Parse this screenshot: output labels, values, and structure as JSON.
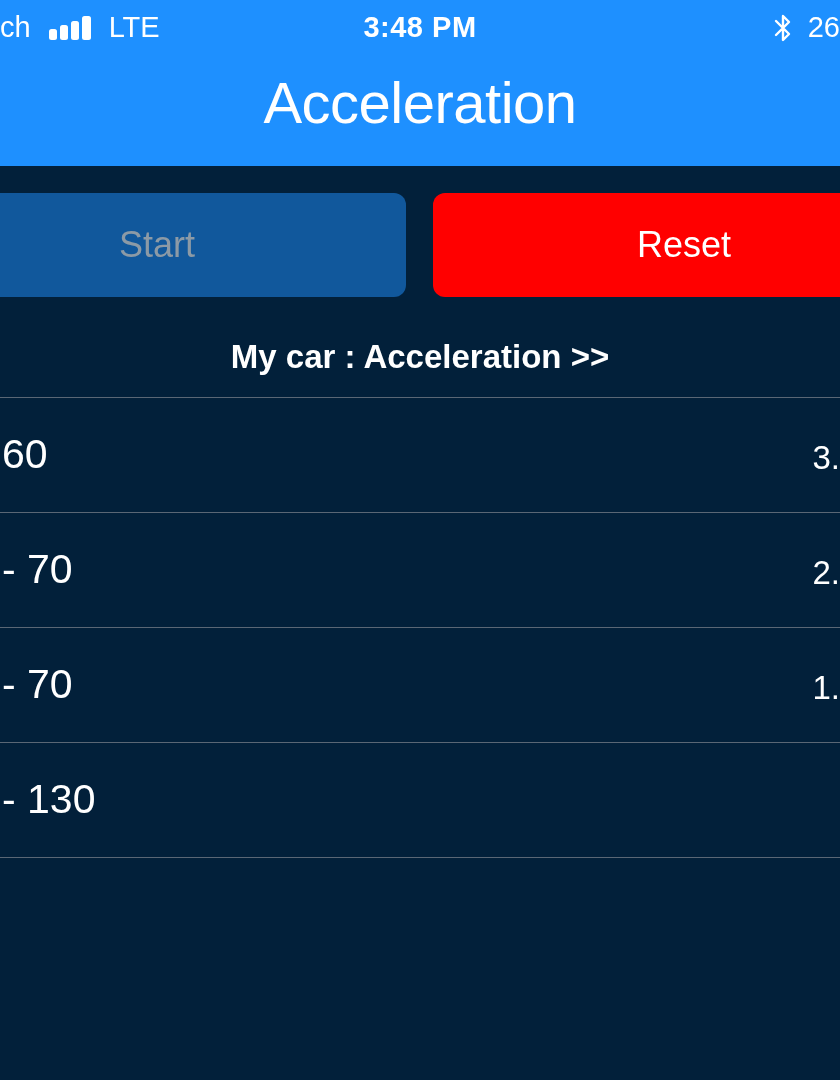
{
  "status_bar": {
    "carrier": "ch",
    "network": "LTE",
    "time": "3:48 PM",
    "right_text": "26"
  },
  "nav_bar": {
    "title": "Acceleration"
  },
  "buttons": [
    {
      "label": "Start",
      "kind": "primary",
      "disabled": true
    },
    {
      "label": "Reset",
      "kind": "destructive",
      "disabled": false
    }
  ],
  "section": {
    "title": "My car : Acceleration >>"
  },
  "rows": [
    {
      "label": "60",
      "value": "3."
    },
    {
      "label": "- 70",
      "value": "2."
    },
    {
      "label": "- 70",
      "value": "1."
    },
    {
      "label": "- 130"
    }
  ]
}
